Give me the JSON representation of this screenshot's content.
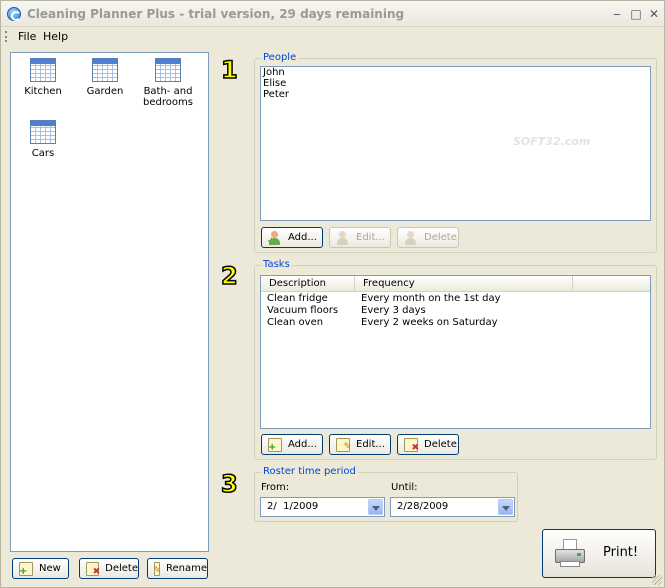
{
  "window": {
    "title": "Cleaning Planner Plus - trial version, 29 days remaining"
  },
  "menu": [
    "File",
    "Help"
  ],
  "rooms": {
    "items": [
      {
        "label": "Kitchen",
        "icon": "calendar-icon"
      },
      {
        "label": "Garden",
        "icon": "calendar-icon"
      },
      {
        "label": "Bath- and bedrooms",
        "icon": "calendar-icon"
      },
      {
        "label": "Cars",
        "icon": "calendar-icon"
      }
    ],
    "buttons": {
      "new": "New",
      "delete": "Delete",
      "rename": "Rename"
    }
  },
  "steps": [
    "1",
    "2",
    "3"
  ],
  "people": {
    "title": "People",
    "names": [
      "John",
      "Elise",
      "Peter"
    ],
    "buttons": {
      "add": "Add...",
      "edit": "Edit...",
      "delete": "Delete"
    },
    "watermark": "SOFT32.com"
  },
  "tasks": {
    "title": "Tasks",
    "columns": [
      "Description",
      "Frequency"
    ],
    "rows": [
      {
        "description": "Clean fridge",
        "frequency": "Every month on the 1st day"
      },
      {
        "description": "Vacuum floors",
        "frequency": "Every 3 days"
      },
      {
        "description": "Clean oven",
        "frequency": "Every 2 weeks on Saturday"
      }
    ],
    "buttons": {
      "add": "Add...",
      "edit": "Edit...",
      "delete": "Delete"
    }
  },
  "roster": {
    "title": "Roster time period",
    "from_label": "From:",
    "until_label": "Until:",
    "from_value": "2/  1/2009",
    "until_value": "2/28/2009"
  },
  "print_button": "Print!",
  "colors": {
    "group_title": "#0046d5",
    "step_number": "#ffff00"
  }
}
